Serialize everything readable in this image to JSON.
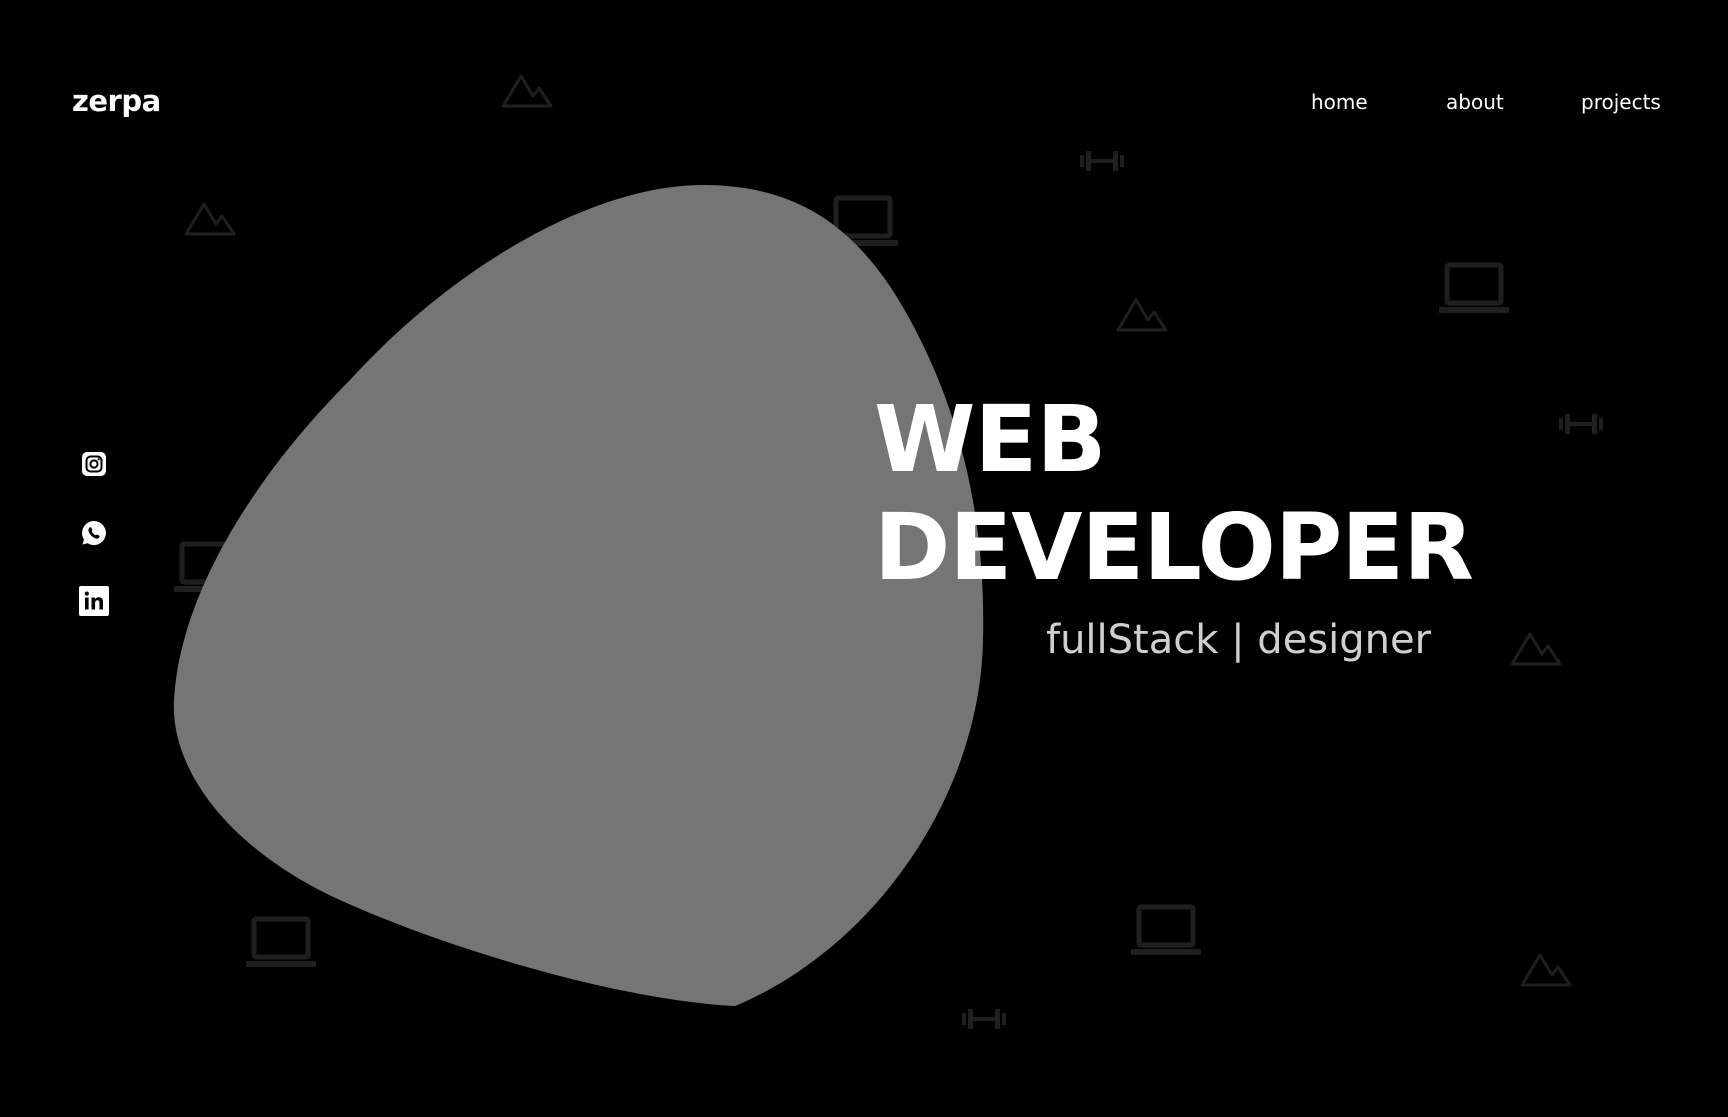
{
  "brand": {
    "name": "zerpa"
  },
  "nav": {
    "items": [
      {
        "label": "home"
      },
      {
        "label": "about"
      },
      {
        "label": "projects"
      }
    ]
  },
  "hero": {
    "title_line1": "WEB",
    "title_line2": "DEVELOPER",
    "subtitle": "fullStack | designer"
  },
  "social": [
    {
      "icon": "instagram-icon"
    },
    {
      "icon": "whatsapp-icon"
    },
    {
      "icon": "linkedin-icon"
    }
  ],
  "background_icons": [
    "mountain-icon",
    "laptop-icon",
    "dumbbell-icon"
  ],
  "colors": {
    "background": "#000000",
    "blob": "#757575",
    "text": "#ffffff",
    "subtitle": "#cfcfcf",
    "pattern": "#1f1f1f"
  }
}
